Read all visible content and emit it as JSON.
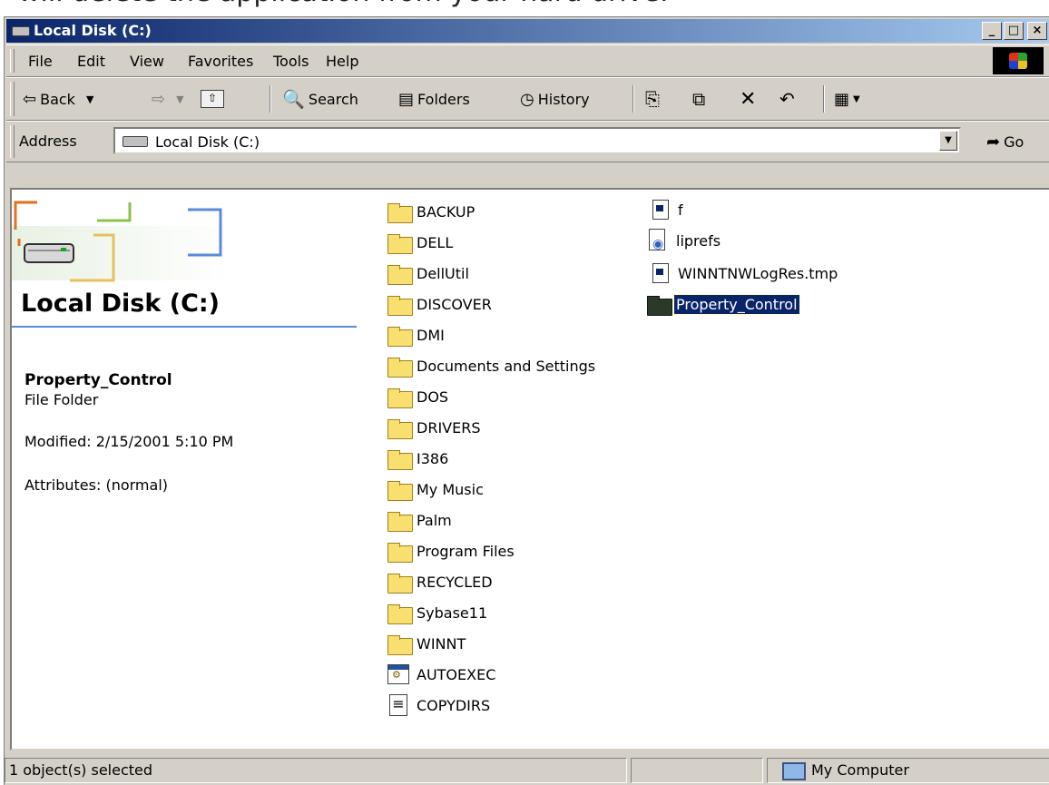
{
  "top_caption": "will delete the application from your hard drive.",
  "window": {
    "title": "Local Disk (C:)",
    "controls": [
      "_",
      "□",
      "×"
    ]
  },
  "menu": [
    "File",
    "Edit",
    "View",
    "Favorites",
    "Tools",
    "Help"
  ],
  "toolbar": {
    "back": "Back",
    "search": "Search",
    "folders": "Folders",
    "history": "History"
  },
  "address": {
    "label": "Address",
    "value": "Local Disk (C:)",
    "go": "Go"
  },
  "left_pane": {
    "title": "Local Disk (C:)",
    "selected_name": "Property_Control",
    "selected_type": "File Folder",
    "modified": "Modified: 2/15/2001 5:10 PM",
    "attributes": "Attributes: (normal)"
  },
  "files_col1": [
    {
      "name": "BACKUP",
      "icon": "folder-icon"
    },
    {
      "name": "DELL",
      "icon": "folder-icon"
    },
    {
      "name": "DellUtil",
      "icon": "folder-icon"
    },
    {
      "name": "DISCOVER",
      "icon": "folder-icon"
    },
    {
      "name": "DMI",
      "icon": "folder-icon"
    },
    {
      "name": "Documents and Settings",
      "icon": "folder-icon"
    },
    {
      "name": "DOS",
      "icon": "folder-icon"
    },
    {
      "name": "DRIVERS",
      "icon": "folder-icon"
    },
    {
      "name": "I386",
      "icon": "folder-icon"
    },
    {
      "name": "My Music",
      "icon": "folder-icon"
    },
    {
      "name": "Palm",
      "icon": "folder-icon"
    },
    {
      "name": "Program Files",
      "icon": "folder-icon"
    },
    {
      "name": "RECYCLED",
      "icon": "folder-icon"
    },
    {
      "name": "Sybase11",
      "icon": "folder-icon"
    },
    {
      "name": "WINNT",
      "icon": "folder-icon"
    },
    {
      "name": "AUTOEXEC",
      "icon": "batch-file-icon"
    },
    {
      "name": "COPYDIRS",
      "icon": "text-file-icon"
    }
  ],
  "files_col2": [
    {
      "name": "f",
      "icon": "document-icon"
    },
    {
      "name": "liprefs",
      "icon": "shortcut-file-icon"
    },
    {
      "name": "WINNTNWLogRes.tmp",
      "icon": "document-icon"
    },
    {
      "name": "Property_Control",
      "icon": "folder-icon",
      "selected": true
    }
  ],
  "status": {
    "selection": "1 object(s) selected",
    "zone": "My Computer"
  },
  "colors": {
    "title_start": "#0a246a",
    "title_end": "#a6caf0",
    "selection": "#0a246a",
    "chrome": "#d4d0c8",
    "folder": "#f8e070"
  }
}
